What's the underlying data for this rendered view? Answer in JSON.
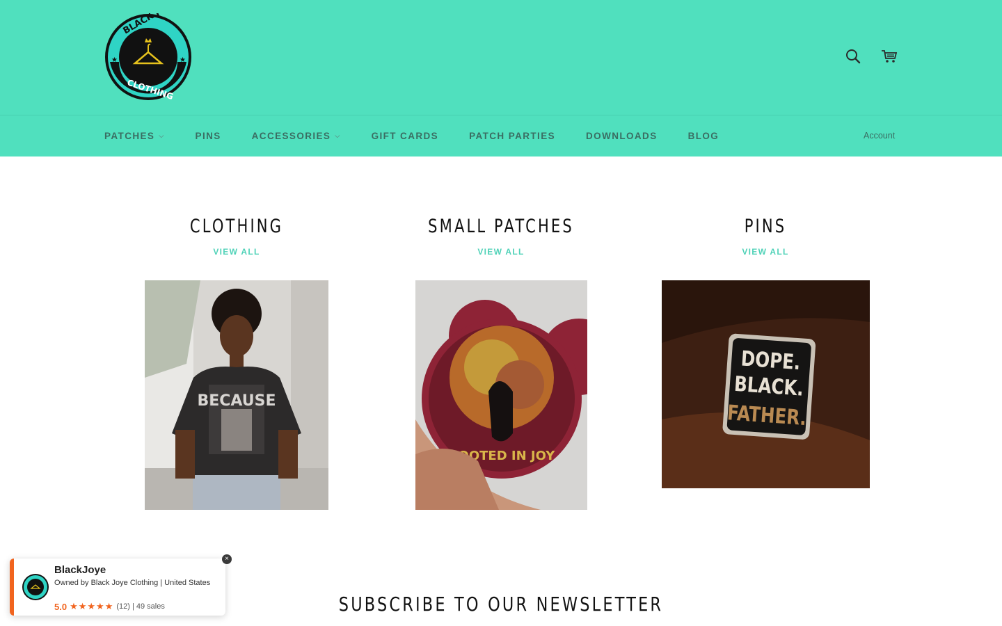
{
  "brand": {
    "logo_top_text": "BLACK JOYE",
    "logo_bottom_text": "CLOTHING"
  },
  "header": {
    "icons": [
      "search-icon",
      "cart-icon"
    ],
    "colors": {
      "header_bg": "#50e0be",
      "accent": "#50d2b8"
    }
  },
  "nav": {
    "items": [
      {
        "label": "PATCHES",
        "has_dropdown": true
      },
      {
        "label": "PINS",
        "has_dropdown": false
      },
      {
        "label": "ACCESSORIES",
        "has_dropdown": true
      },
      {
        "label": "GIFT CARDS",
        "has_dropdown": false
      },
      {
        "label": "PATCH PARTIES",
        "has_dropdown": false
      },
      {
        "label": "DOWNLOADS",
        "has_dropdown": false
      },
      {
        "label": "BLOG",
        "has_dropdown": false
      }
    ],
    "account": "Account"
  },
  "collections": [
    {
      "title": "CLOTHING",
      "link": "VIEW ALL"
    },
    {
      "title": "SMALL PATCHES",
      "link": "VIEW ALL"
    },
    {
      "title": "PINS",
      "link": "VIEW ALL"
    }
  ],
  "patch_text": "ROOTED IN JOY",
  "pin_text": [
    "DOPE.",
    "BLACK.",
    "FATHER."
  ],
  "shirt_text": "BECAUSE",
  "newsletter": {
    "title": "SUBSCRIBE TO OUR NEWSLETTER"
  },
  "popup": {
    "name": "BlackJoye",
    "owner": "Owned by Black Joye Clothing | United States",
    "rating": "5.0",
    "reviews": "(12) | 49 sales",
    "close": "×"
  }
}
